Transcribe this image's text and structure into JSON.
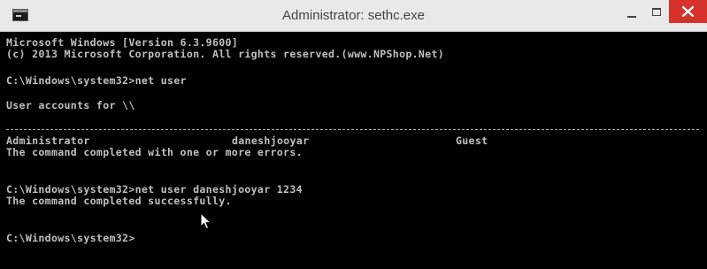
{
  "window": {
    "title": "Administrator: sethc.exe"
  },
  "console": {
    "header_line1": "Microsoft Windows [Version 6.3.9600]",
    "header_line2": "(c) 2013 Microsoft Corporation. All rights reserved.(www.NPShop.Net)",
    "cmd1": "C:\\Windows\\system32>net user",
    "accounts_heading": "User accounts for \\\\",
    "accounts": [
      "Administrator",
      "daneshjooyar",
      "Guest"
    ],
    "result1": "The command completed with one or more errors.",
    "cmd2": "C:\\Windows\\system32>net user daneshjooyar 1234",
    "result2": "The command completed successfully.",
    "prompt": "C:\\Windows\\system32>"
  },
  "colors": {
    "titlebar_bg": "#e9e9e9",
    "console_bg": "#000000",
    "console_text": "#c0c0c0",
    "close_button": "#d7322b"
  },
  "icons": [
    "console-app-icon",
    "minimize-icon",
    "maximize-icon",
    "close-icon",
    "mouse-pointer-icon"
  ]
}
